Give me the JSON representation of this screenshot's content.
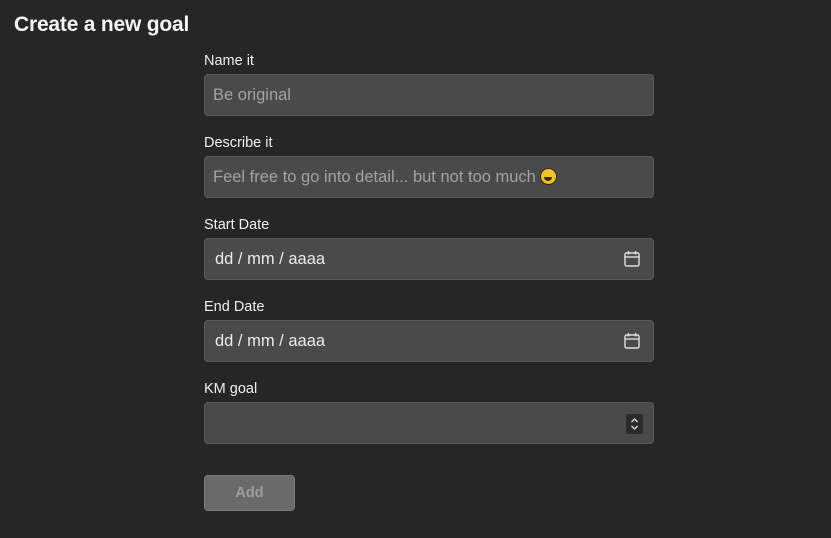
{
  "page": {
    "title": "Create a new goal"
  },
  "form": {
    "name": {
      "label": "Name it",
      "placeholder": "Be original",
      "value": ""
    },
    "description": {
      "label": "Describe it",
      "placeholder": "Feel free to go into detail... but not too much",
      "emoji_icon": "rolling-on-floor-laughing-emoji"
    },
    "start_date": {
      "label": "Start Date",
      "value": "dd / mm / aaaa",
      "icon": "calendar-icon"
    },
    "end_date": {
      "label": "End Date",
      "value": "dd / mm / aaaa",
      "icon": "calendar-icon"
    },
    "km_goal": {
      "label": "KM goal",
      "value": "",
      "icon": "spinner-icon"
    },
    "submit_label": "Add"
  },
  "colors": {
    "background": "#262626",
    "input_background": "#4a4a4a",
    "button_background": "#6a6a6a"
  }
}
